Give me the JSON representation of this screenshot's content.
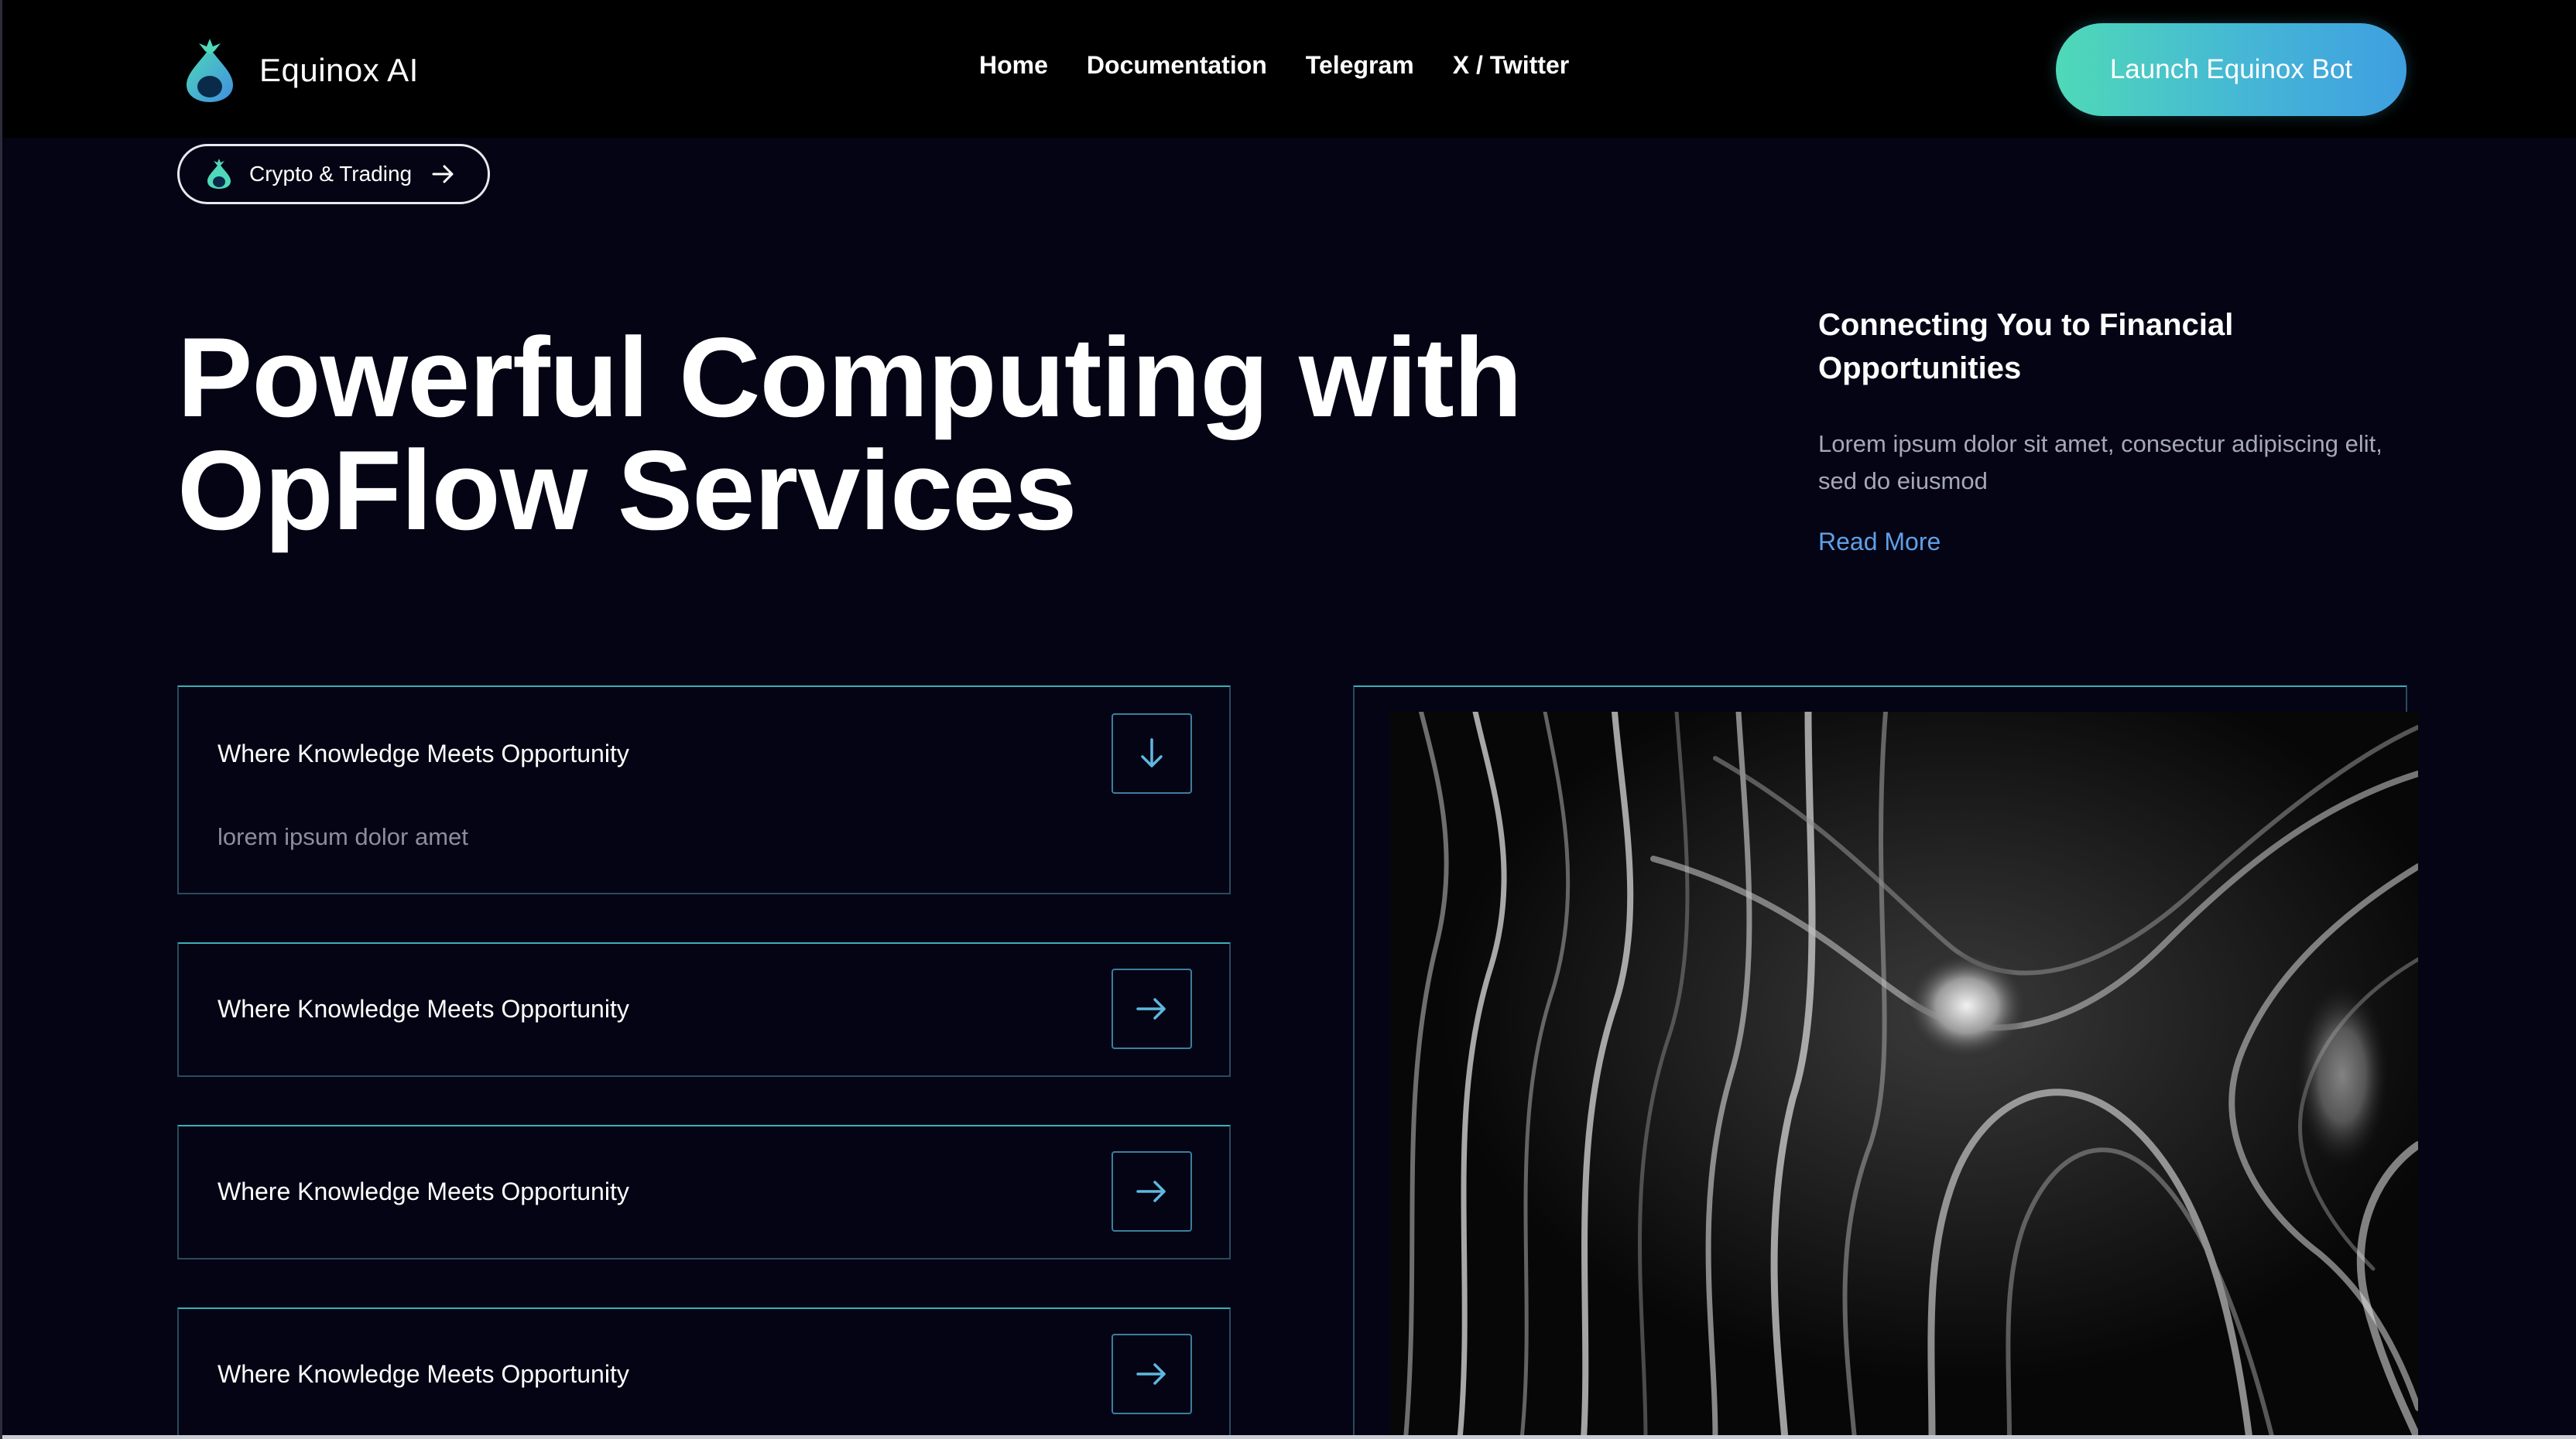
{
  "brand": {
    "name": "Equinox AI",
    "logo_icon": "droplet-logo-icon",
    "accent_start": "#4fd9b8",
    "accent_end": "#3f9fe0"
  },
  "nav": {
    "items": [
      {
        "label": "Home"
      },
      {
        "label": "Documentation"
      },
      {
        "label": "Telegram"
      },
      {
        "label": "X / Twitter"
      }
    ]
  },
  "header": {
    "cta_label": "Launch Equinox Bot"
  },
  "pill": {
    "label": "Crypto & Trading",
    "icon": "arrow-right-icon"
  },
  "hero": {
    "title_line1": "Powerful Computing with",
    "title_line2": "OpFlow Services"
  },
  "side": {
    "heading": "Connecting You to Financial Opportunities",
    "text": "Lorem ipsum dolor sit amet, consectur adipiscing elit, sed do eiusmod",
    "link": "Read More",
    "link_color": "#5fa0e8"
  },
  "cards": [
    {
      "title": "Where Knowledge Meets Opportunity",
      "subtitle": "lorem ipsum dolor amet",
      "expanded": true,
      "icon": "arrow-down-icon"
    },
    {
      "title": "Where Knowledge Meets Opportunity",
      "expanded": false,
      "icon": "arrow-right-icon"
    },
    {
      "title": "Where Knowledge Meets Opportunity",
      "expanded": false,
      "icon": "arrow-right-icon"
    },
    {
      "title": "Where Knowledge Meets Opportunity",
      "expanded": false,
      "icon": "arrow-right-icon"
    }
  ]
}
